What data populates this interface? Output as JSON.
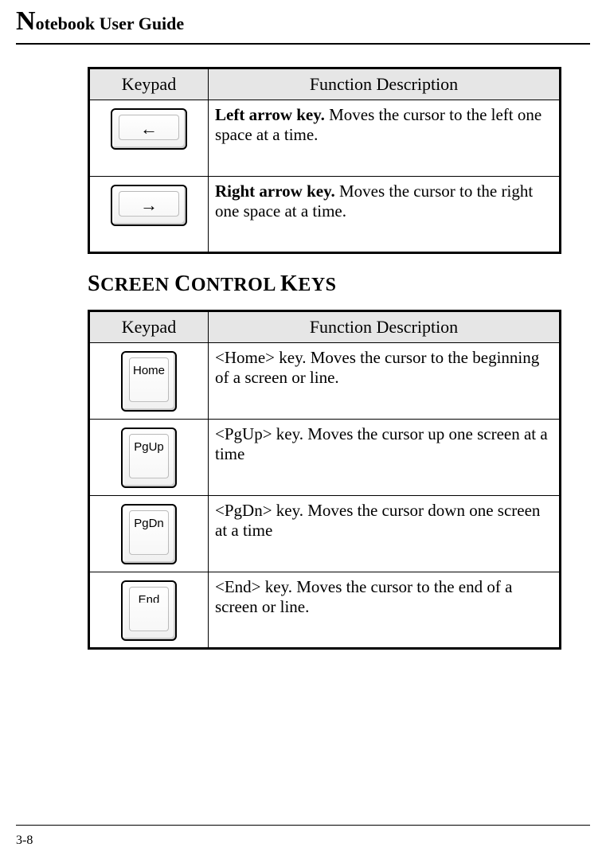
{
  "header": {
    "title_prefix": "N",
    "title_rest": "otebook User Guide"
  },
  "page_number": "3-8",
  "table1": {
    "headers": {
      "keypad": "Keypad",
      "desc": "Function Description"
    },
    "rows": [
      {
        "icon": "left-arrow",
        "bold": "Left arrow key.",
        "rest": " Moves the cursor to the left one space at a time."
      },
      {
        "icon": "right-arrow",
        "bold": "Right arrow key.",
        "rest": " Moves the cursor to the right one space at a time."
      }
    ]
  },
  "section_title": {
    "w1c": "S",
    "w1r": "CREEN ",
    "w2c": "C",
    "w2r": "ONTROL ",
    "w3c": "K",
    "w3r": "EYS"
  },
  "table2": {
    "headers": {
      "keypad": "Keypad",
      "desc": "Function Description"
    },
    "rows": [
      {
        "label": "Home",
        "text": "<Home> key. Moves the cursor to the beginning of a screen or line."
      },
      {
        "label": "PgUp",
        "text": "<PgUp> key. Moves the cursor up one screen at a time"
      },
      {
        "label": "PgDn",
        "text": "<PgDn> key. Moves the cursor down one screen at a time"
      },
      {
        "label": "End",
        "text": "<End> key. Moves the cursor to the end of a screen or line."
      }
    ]
  }
}
